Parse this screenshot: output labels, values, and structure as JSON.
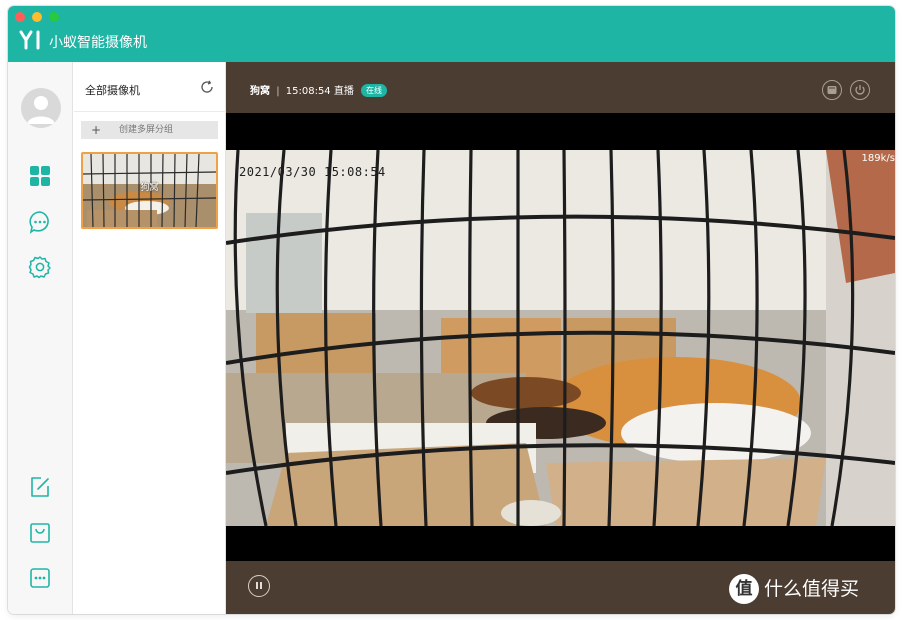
{
  "app": {
    "brand": "YI",
    "title": "小蚁智能摄像机",
    "accent_color": "#1fb5a5"
  },
  "sidebar": {
    "items": [
      {
        "icon": "grid-icon",
        "active": true
      },
      {
        "icon": "message-icon"
      },
      {
        "icon": "settings-gear-icon"
      },
      {
        "icon": "edit-icon"
      },
      {
        "icon": "bag-icon"
      },
      {
        "icon": "more-icon"
      }
    ]
  },
  "camera_list": {
    "title": "全部摄像机",
    "create_group_label": "创建多屏分组",
    "cameras": [
      {
        "name": "狗窝",
        "selected": true
      }
    ]
  },
  "player": {
    "camera_name": "狗窝",
    "separator": "|",
    "time": "15:08:54",
    "mode": "直播",
    "status_badge": "在线",
    "osd_timestamp": "2021/03/30  15:08:54",
    "bitrate": "189k/s"
  },
  "watermark": {
    "logo_char": "值",
    "text": "什么值得买"
  }
}
